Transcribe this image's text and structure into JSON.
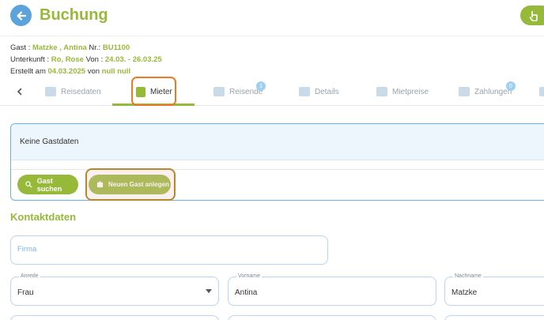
{
  "header": {
    "title": "Buchung"
  },
  "info": {
    "gast_label": "Gast : ",
    "gast_name": "Matzke , Antina",
    "nr_label": " Nr.: ",
    "nr_value": "BU1100",
    "unterkunft_label": "Unterkunft : ",
    "unterkunft_value": "Ro, Rose",
    "von_label": " Von : ",
    "von_value": "24.03. - 26.03.25",
    "erstellt_label": "Erstellt am ",
    "erstellt_date": "04.03.2025",
    "von2_label": " von ",
    "von2_value": "null null"
  },
  "tabs": [
    {
      "label": "Reisedaten",
      "icon": "luggage-icon"
    },
    {
      "label": "Mieter",
      "icon": "id-card-icon",
      "active": true
    },
    {
      "label": "Reisende",
      "icon": "people-icon",
      "badge": "1"
    },
    {
      "label": "Details",
      "icon": "list-icon"
    },
    {
      "label": "Mietpreise",
      "icon": "coins-icon"
    },
    {
      "label": "Zahlungen",
      "icon": "money-icon",
      "badge": "0"
    }
  ],
  "guest": {
    "empty_text": "Keine Gastdaten",
    "search_label": "Gast suchen",
    "new_label": "Neuen Gast anlegen"
  },
  "contact": {
    "title": "Kontaktdaten",
    "firma_placeholder": "Firma",
    "anrede_label": "Anrede",
    "anrede_value": "Frau",
    "vorname_label": "Vorname",
    "vorname_value": "Antina",
    "nachname_label": "Nachname",
    "nachname_value": "Matzke"
  },
  "colors": {
    "brand_green": "#97b93a",
    "accent_blue": "#5aa3dc",
    "highlight_orange": "#e97a28",
    "highlight_brown": "#b38a2a"
  }
}
